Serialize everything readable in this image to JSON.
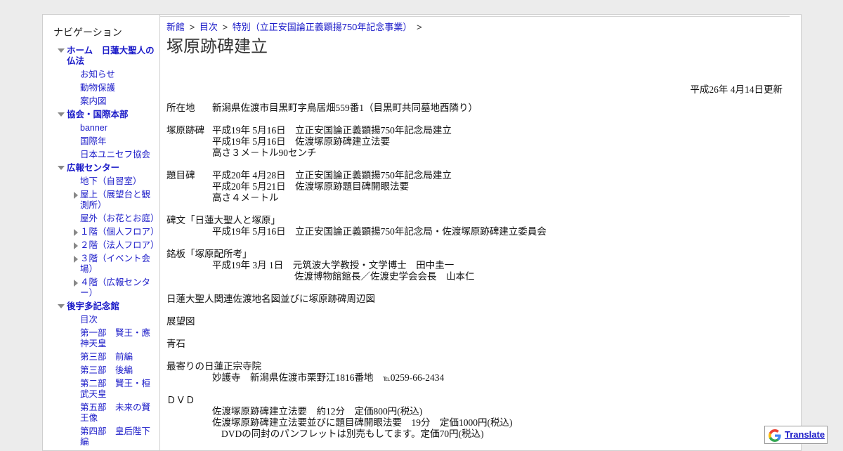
{
  "sidebar": {
    "title": "ナビゲーション",
    "items": [
      {
        "label": "ホーム　日蓮大聖人の仏法",
        "level": 1,
        "icon": "collapse-triangle-icon"
      },
      {
        "label": "お知らせ",
        "level": 2
      },
      {
        "label": "動物保護",
        "level": 2
      },
      {
        "label": "案内図",
        "level": 2
      },
      {
        "label": "協会・国際本部",
        "level": 1,
        "icon": "collapse-triangle-icon"
      },
      {
        "label": "banner",
        "level": 2
      },
      {
        "label": "国際年",
        "level": 2
      },
      {
        "label": "日本ユニセフ協会",
        "level": 2
      },
      {
        "label": "広報センター",
        "level": 1,
        "icon": "collapse-triangle-icon"
      },
      {
        "label": "地下（自習室）",
        "level": 2
      },
      {
        "label": "屋上（展望台と観測所）",
        "level": 2,
        "icon": "expand-triangle-icon"
      },
      {
        "label": "屋外（お花とお庭）",
        "level": 2
      },
      {
        "label": "１階（個人フロア）",
        "level": 2,
        "icon": "expand-triangle-icon"
      },
      {
        "label": "２階（法人フロア）",
        "level": 2,
        "icon": "expand-triangle-icon"
      },
      {
        "label": "３階（イベント会場）",
        "level": 2,
        "icon": "expand-triangle-icon"
      },
      {
        "label": "４階（広報センター）",
        "level": 2,
        "icon": "expand-triangle-icon"
      },
      {
        "label": "後宇多記念館",
        "level": 1,
        "icon": "collapse-triangle-icon"
      },
      {
        "label": "目次",
        "level": 2
      },
      {
        "label": "第一部　賢王・應神天皇",
        "level": 2
      },
      {
        "label": "第三部　前編",
        "level": 2
      },
      {
        "label": "第三部　後編",
        "level": 2
      },
      {
        "label": "第二部　賢王・桓武天皇",
        "level": 2
      },
      {
        "label": "第五部　未来の賢王像",
        "level": 2
      },
      {
        "label": "第四部　皇后陛下編",
        "level": 2
      }
    ]
  },
  "breadcrumb": {
    "items": [
      "新館",
      "目次",
      "特別（立正安国論正義顕揚750年記念事業）"
    ],
    "separator": ">"
  },
  "page": {
    "title": "塚原跡碑建立",
    "updated": "平成26年 4月14日更新"
  },
  "content": {
    "location_label": "所在地",
    "location_value": "新潟県佐渡市目黒町字鳥居畑559番1（目黒町共同墓地西隣り）",
    "monument_label": "塚原跡碑",
    "monument_lines": [
      "平成19年 5月16日　立正安国論正義顕揚750年記念局建立",
      "平成19年 5月16日　佐渡塚原跡碑建立法要",
      "高さ３メ－トル90センチ"
    ],
    "title_monument_label": "題目碑",
    "title_monument_lines": [
      "平成20年 4月28日　立正安国論正義顕揚750年記念局建立",
      "平成20年 5月21日　佐渡塚原跡題目碑開眼法要",
      "高さ４メ－トル"
    ],
    "inscription_label": "碑文「日蓮大聖人と塚原」",
    "inscription_line": "平成19年 5月16日　立正安国論正義顕揚750年記念局・佐渡塚原跡碑建立委員会",
    "plaque_label": "銘板「塚原配所考」",
    "plaque_line1": "平成19年 3月 1日　元筑波大学教授・文学博士　田中圭一",
    "plaque_line2": "佐渡博物館館長／佐渡史学会会長　山本仁",
    "map_title": "日蓮大聖人関連佐渡地名図並びに塚原跡碑周辺図",
    "view_title": "展望図",
    "stone_title": "青石",
    "temple_label": "最寄りの日蓮正宗寺院",
    "temple_line": "妙護寺　新潟県佐渡市栗野江1816番地",
    "temple_tel_prefix": "℡",
    "temple_tel": "0259-66-2434",
    "dvd_label": "ＤＶＤ",
    "dvd_lines": [
      "佐渡塚原跡碑建立法要　約12分　定価800円(税込)",
      "佐渡塚原跡碑建立法要並びに題目碑開眼法要　19分　定価1000円(税込)"
    ],
    "dvd_note": "DVDの同封のパンフレットは別売もしてます。定価70円(税込)"
  },
  "translate": {
    "label": "Translate",
    "icon": "google-g-icon"
  }
}
